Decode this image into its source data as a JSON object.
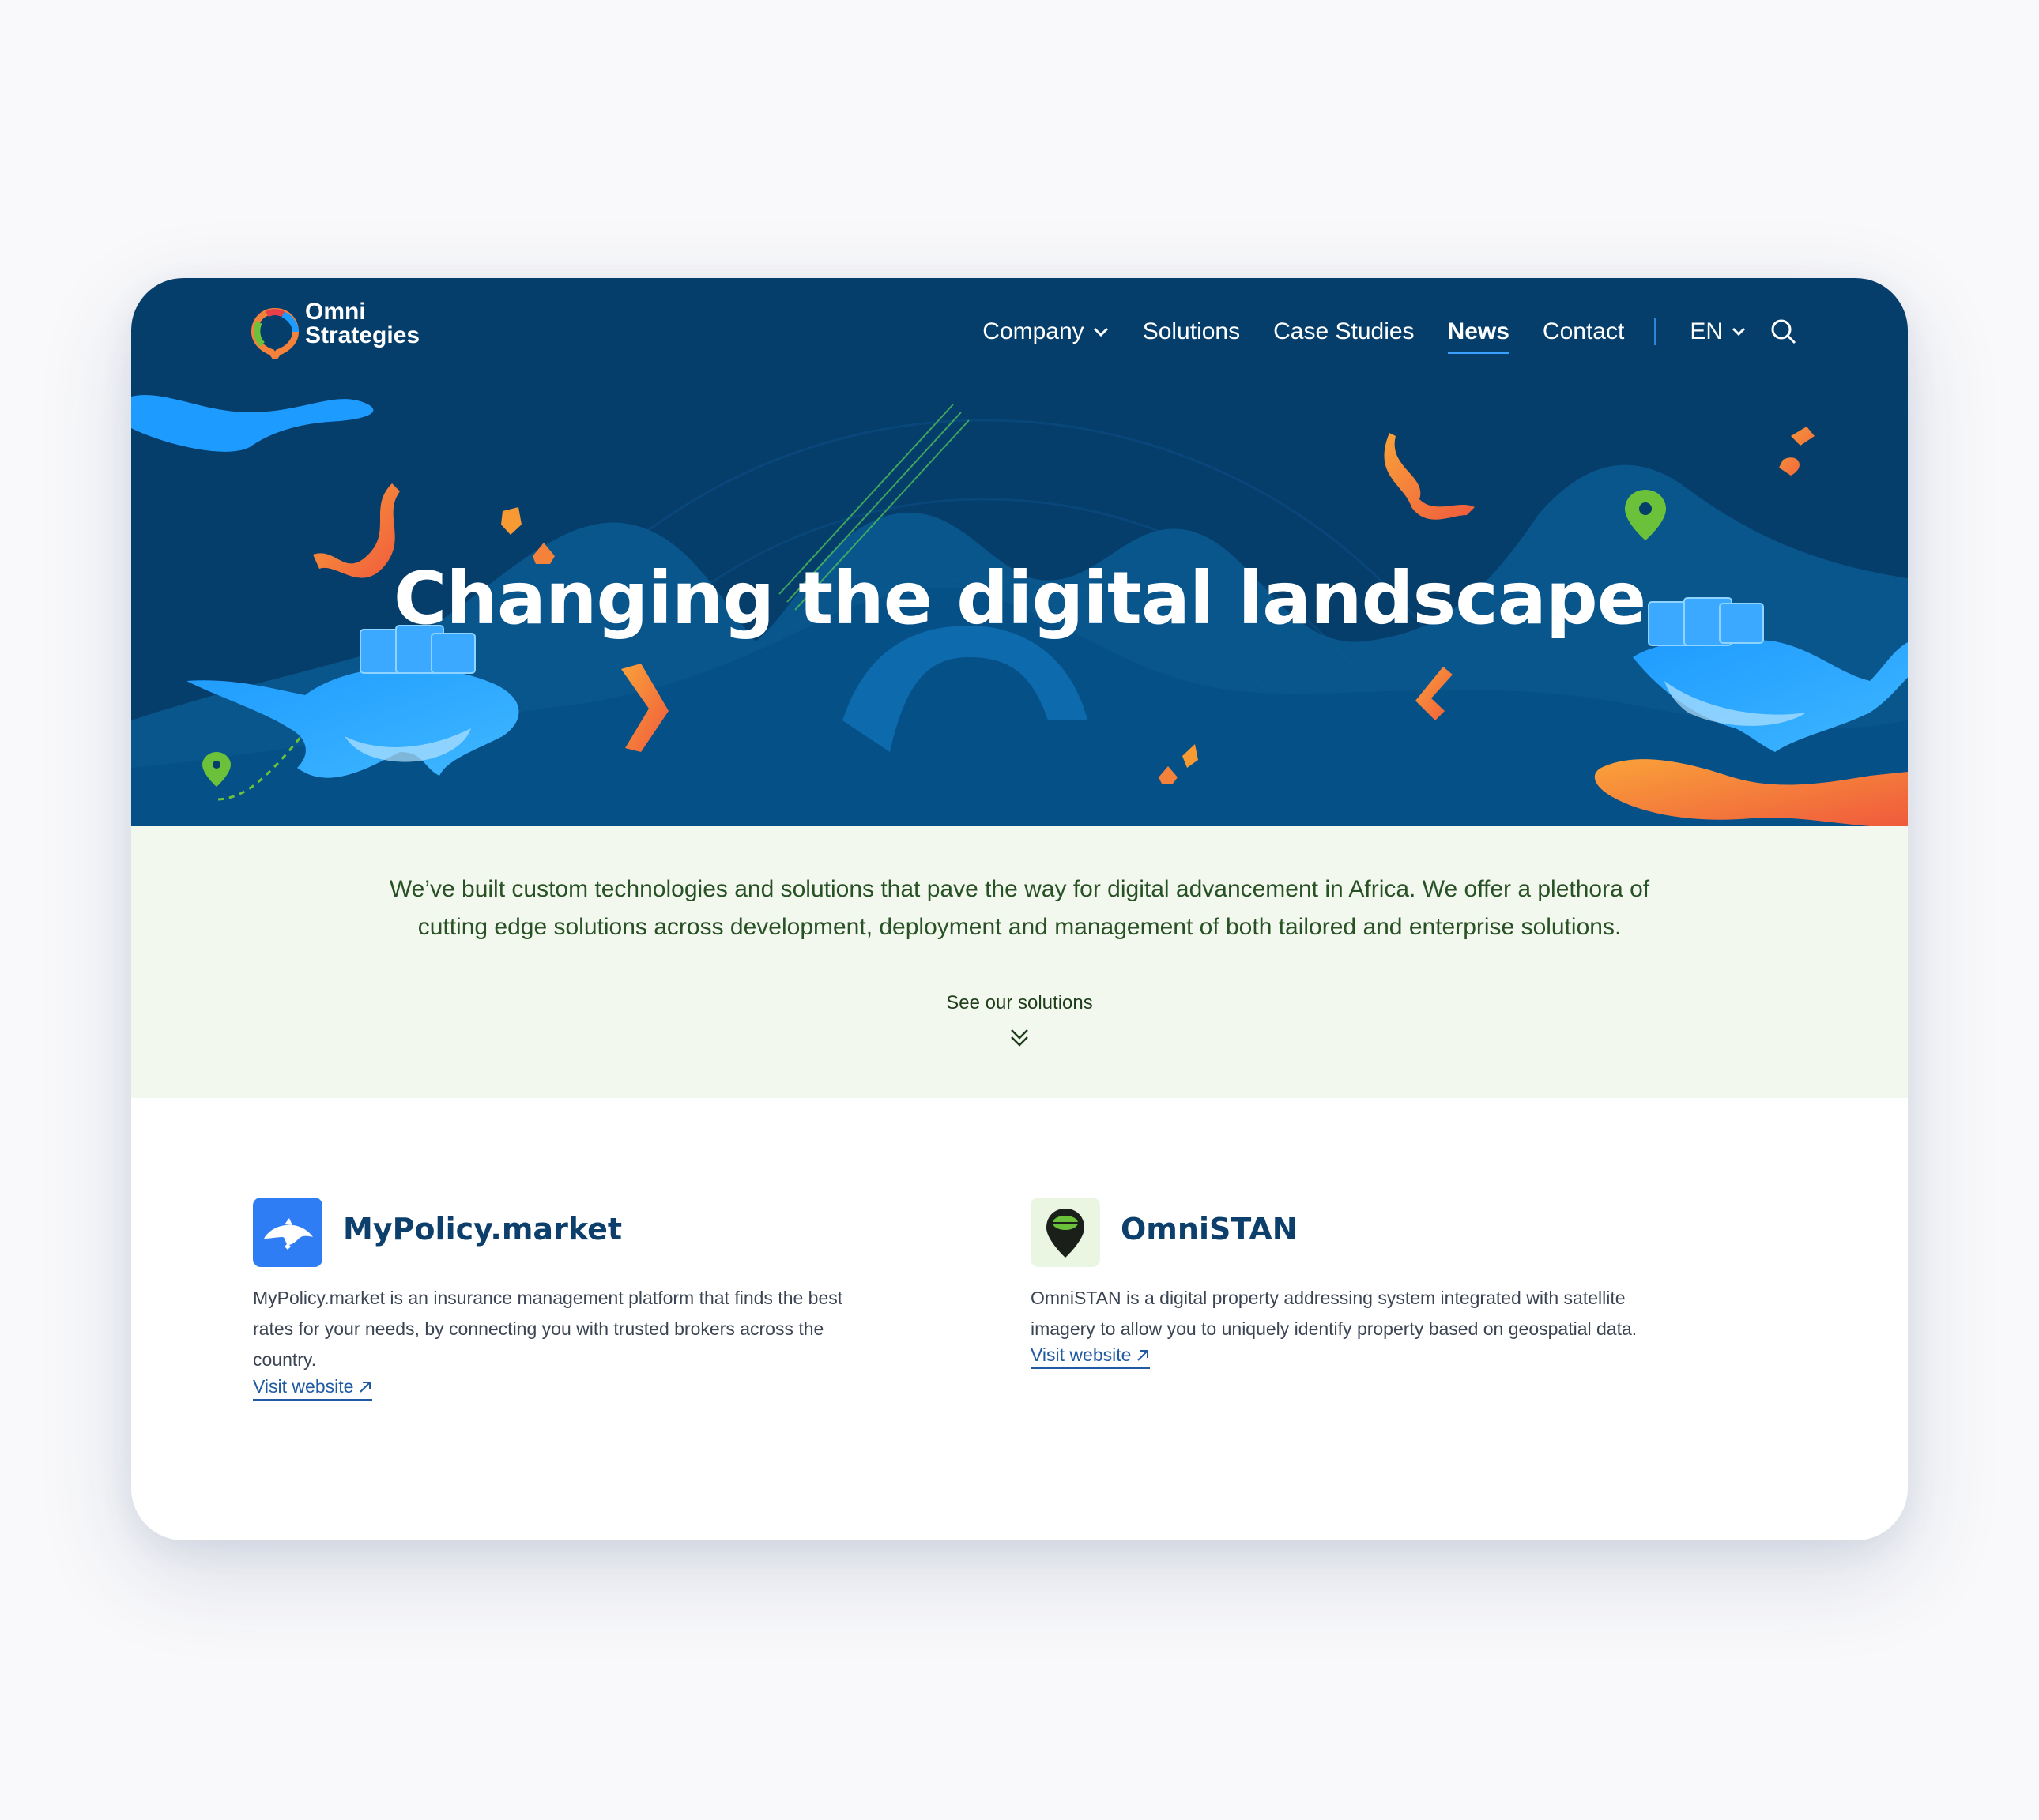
{
  "brand": {
    "line1": "Omni",
    "line2": "Strategies"
  },
  "nav": {
    "items": [
      {
        "label": "Company",
        "dropdown": true
      },
      {
        "label": "Solutions"
      },
      {
        "label": "Case Studies"
      },
      {
        "label": "News",
        "active": true
      },
      {
        "label": "Contact"
      }
    ],
    "language": "EN"
  },
  "hero": {
    "title": "Changing the digital landscape"
  },
  "intro": {
    "text": "We’ve built custom technologies and solutions that pave the way for digital advancement in Africa. We offer a plethora of cutting edge solutions across development, deployment and management of both tailored and enterprise solutions.",
    "cta": "See our solutions"
  },
  "products": [
    {
      "name": "MyPolicy.market",
      "description": "MyPolicy.market is an insurance management platform that finds the best rates for your needs, by connecting you with trusted brokers across the country.",
      "link": "Visit website",
      "icon": "dolphin-icon"
    },
    {
      "name": "OmniSTAN",
      "description": "OmniSTAN is a digital property addressing system integrated with satellite imagery to allow you to uniquely identify property based on geospatial data.",
      "link": "Visit website",
      "icon": "omnistan-logo-icon"
    }
  ],
  "colors": {
    "hero_bg": "#053d6b",
    "intro_bg": "#f3f8ee",
    "accent_orange": "#f5823a",
    "accent_blue": "#1e9bff",
    "accent_green": "#6cc13a",
    "brand_navy": "#0d3f6d"
  }
}
